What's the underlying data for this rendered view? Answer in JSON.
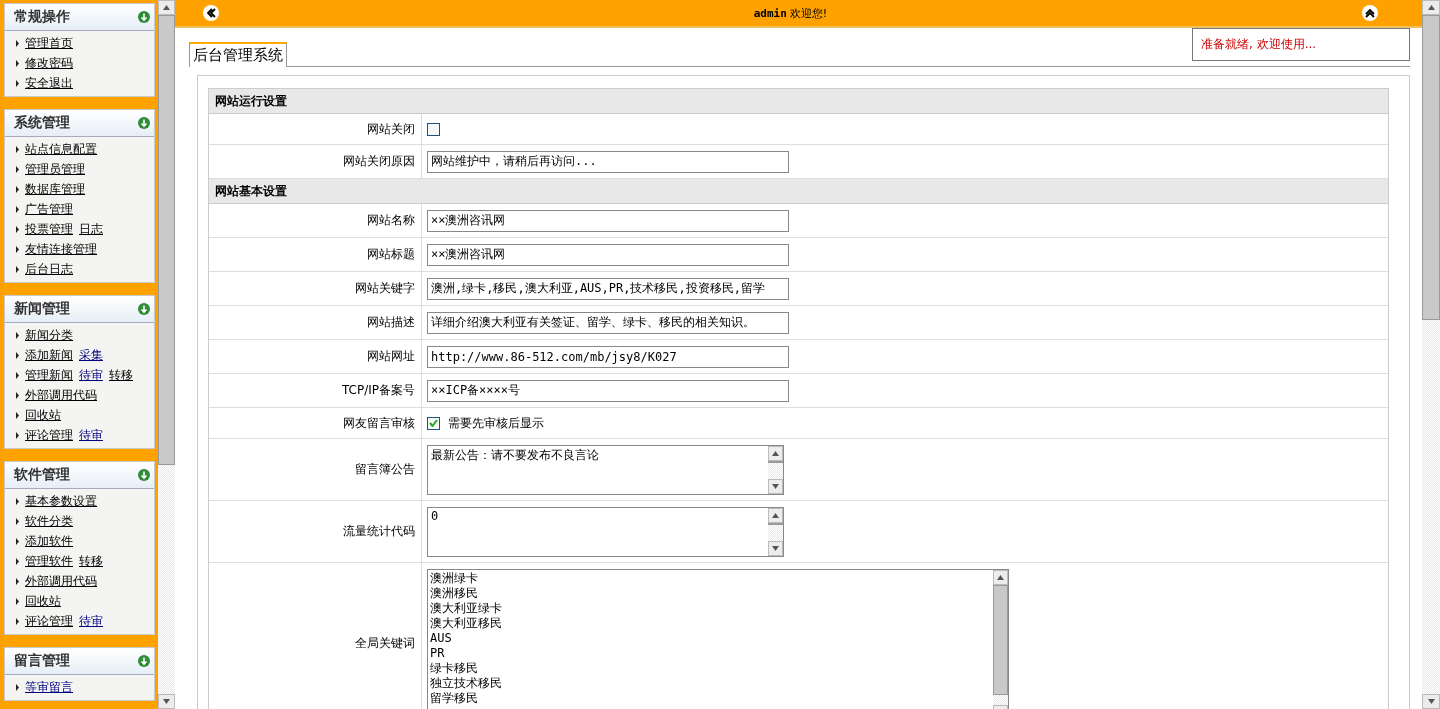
{
  "sidebar": {
    "groups": [
      {
        "title": "常规操作",
        "items": [
          {
            "links": [
              {
                "text": "管理首页",
                "color": "#000000"
              }
            ]
          },
          {
            "links": [
              {
                "text": "修改密码",
                "color": "#000000"
              }
            ]
          },
          {
            "links": [
              {
                "text": "安全退出",
                "color": "#000000"
              }
            ]
          }
        ]
      },
      {
        "title": "系统管理",
        "items": [
          {
            "links": [
              {
                "text": "站点信息配置",
                "color": "#000000"
              }
            ]
          },
          {
            "links": [
              {
                "text": "管理员管理",
                "color": "#000000"
              }
            ]
          },
          {
            "links": [
              {
                "text": "数据库管理",
                "color": "#000000"
              }
            ]
          },
          {
            "links": [
              {
                "text": "广告管理",
                "color": "#000000"
              }
            ]
          },
          {
            "links": [
              {
                "text": "投票管理",
                "color": "#000000"
              },
              {
                "text": "日志",
                "color": "#000000"
              }
            ]
          },
          {
            "links": [
              {
                "text": "友情连接管理",
                "color": "#000000"
              }
            ]
          },
          {
            "links": [
              {
                "text": "后台日志",
                "color": "#000000"
              }
            ]
          }
        ]
      },
      {
        "title": "新闻管理",
        "items": [
          {
            "links": [
              {
                "text": "新闻分类",
                "color": "#000000"
              }
            ]
          },
          {
            "links": [
              {
                "text": "添加新闻",
                "color": "#000000"
              },
              {
                "text": "采集",
                "color": "#000080"
              }
            ]
          },
          {
            "links": [
              {
                "text": "管理新闻",
                "color": "#000000"
              },
              {
                "text": "待审",
                "color": "#000080"
              },
              {
                "text": "转移",
                "color": "#000000"
              }
            ]
          },
          {
            "links": [
              {
                "text": "外部调用代码",
                "color": "#000000"
              }
            ]
          },
          {
            "links": [
              {
                "text": "回收站",
                "color": "#000000"
              }
            ]
          },
          {
            "links": [
              {
                "text": "评论管理",
                "color": "#000000"
              },
              {
                "text": "待审",
                "color": "#000080"
              }
            ]
          }
        ]
      },
      {
        "title": "软件管理",
        "items": [
          {
            "links": [
              {
                "text": "基本参数设置",
                "color": "#000000"
              }
            ]
          },
          {
            "links": [
              {
                "text": "软件分类",
                "color": "#000000"
              }
            ]
          },
          {
            "links": [
              {
                "text": "添加软件",
                "color": "#000000"
              }
            ]
          },
          {
            "links": [
              {
                "text": "管理软件",
                "color": "#000000"
              },
              {
                "text": "转移",
                "color": "#000000"
              }
            ]
          },
          {
            "links": [
              {
                "text": "外部调用代码",
                "color": "#000000"
              }
            ]
          },
          {
            "links": [
              {
                "text": "回收站",
                "color": "#000000"
              }
            ]
          },
          {
            "links": [
              {
                "text": "评论管理",
                "color": "#000000"
              },
              {
                "text": "待审",
                "color": "#000080"
              }
            ]
          }
        ]
      },
      {
        "title": "留言管理",
        "items": [
          {
            "links": [
              {
                "text": "等审留言",
                "color": "#000080"
              }
            ]
          }
        ]
      }
    ]
  },
  "topbar": {
    "user": "admin",
    "greeting": "欢迎您!"
  },
  "status": "准备就绪, 欢迎使用...",
  "tab": {
    "label": "后台管理系统"
  },
  "form": [
    {
      "kind": "section",
      "label": "网站运行设置"
    },
    {
      "kind": "checkbox",
      "label": "网站关闭",
      "checked": false
    },
    {
      "kind": "text",
      "label": "网站关闭原因",
      "value": "网站维护中，请稍后再访问..."
    },
    {
      "kind": "section",
      "label": "网站基本设置"
    },
    {
      "kind": "text",
      "label": "网站名称",
      "value": "××澳洲咨讯网"
    },
    {
      "kind": "text",
      "label": "网站标题",
      "value": "××澳洲咨讯网"
    },
    {
      "kind": "text",
      "label": "网站关键字",
      "value": "澳洲,绿卡,移民,澳大利亚,AUS,PR,技术移民,投资移民,留学"
    },
    {
      "kind": "text",
      "label": "网站描述",
      "value": "详细介绍澳大利亚有关签证、留学、绿卡、移民的相关知识。"
    },
    {
      "kind": "text",
      "label": "网站网址",
      "value": "http://www.86-512.com/mb/jsy8/K027"
    },
    {
      "kind": "text",
      "label": "TCP/IP备案号",
      "value": "××ICP备××××号"
    },
    {
      "kind": "checkbox",
      "label": "网友留言审核",
      "checked": true,
      "text": "需要先审核后显示"
    },
    {
      "kind": "textarea",
      "label": "留言簿公告",
      "value": "最新公告：请不要发布不良言论"
    },
    {
      "kind": "textarea",
      "label": "流量统计代码",
      "value": "0"
    },
    {
      "kind": "listbox",
      "label": "全局关键词",
      "options": [
        "澳洲绿卡",
        "澳洲移民",
        "澳大利亚绿卡",
        "澳大利亚移民",
        "AUS",
        "PR",
        "绿卡移民",
        "独立技术移民",
        "留学移民"
      ]
    }
  ]
}
